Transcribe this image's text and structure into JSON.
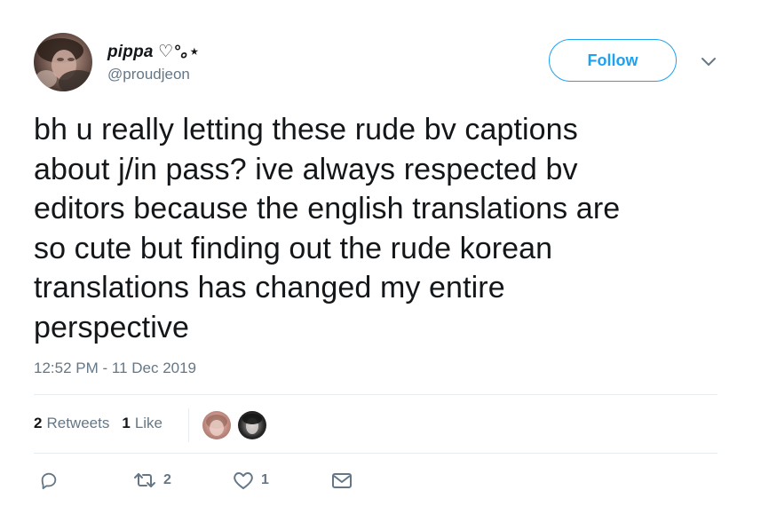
{
  "user": {
    "display_name": "pippa ♡°｡⋆",
    "handle": "@proudjeon"
  },
  "follow_button": {
    "label": "Follow"
  },
  "tweet": {
    "text": "bh u really letting these rude bv captions\nabout j/in pass? ive always respected bv\neditors because the english translations are\nso cute but finding out the rude korean\ntranslations has changed my entire\nperspective",
    "timestamp": "12:52 PM - 11 Dec 2019"
  },
  "stats": {
    "retweets_count": "2",
    "retweets_label": "Retweets",
    "likes_count": "1",
    "likes_label": "Like"
  },
  "actions": {
    "reply_icon": "reply-icon",
    "retweet_icon": "retweet-icon",
    "retweet_count": "2",
    "like_icon": "heart-icon",
    "like_count": "1",
    "dm_icon": "envelope-icon"
  },
  "colors": {
    "accent": "#1da1f2",
    "text": "#14171a",
    "muted": "#657786",
    "divider": "#e6ecf0"
  }
}
